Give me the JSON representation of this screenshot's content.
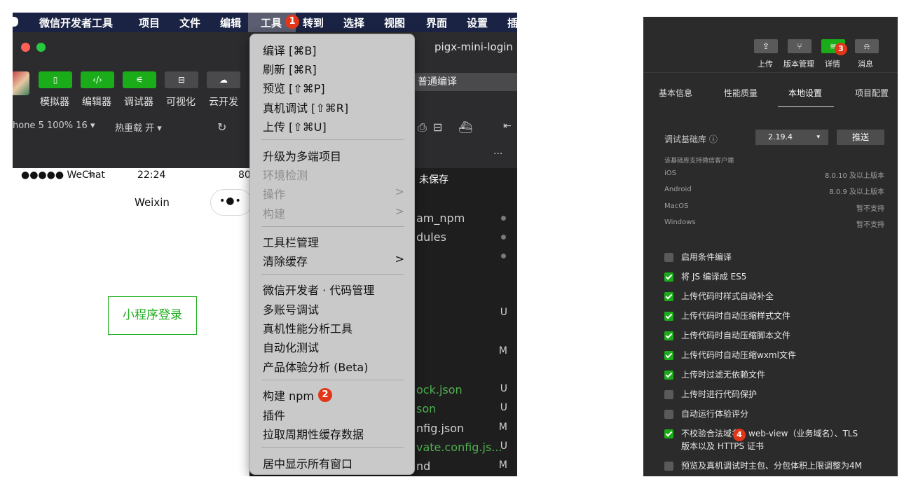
{
  "left": {
    "menubar": {
      "items": [
        "微信开发者工具",
        "项目",
        "文件",
        "编辑",
        "工具",
        "转到",
        "选择",
        "视图",
        "界面",
        "设置",
        "插"
      ]
    },
    "title": "pigx-mini-login",
    "toolbar": {
      "buttons": [
        "模拟器",
        "编辑器",
        "调试器",
        "可视化",
        "云开发"
      ],
      "compile_mode": "普通编译"
    },
    "status": {
      "device": "hone 5 100% 16 ▾",
      "hot_reload": "热重载 开 ▾",
      "more": "..."
    },
    "phone": {
      "signal": "●●●●● WeChat",
      "time": "22:24",
      "battery": "80",
      "nav_title": "Weixin",
      "capsule": "•●•",
      "login_button": "小程序登录"
    },
    "editor": {
      "unsaved": "未保存",
      "files": [
        {
          "text": "am_npm",
          "tag": ""
        },
        {
          "text": "dules",
          "tag": ""
        },
        {
          "text": "",
          "tag": ""
        },
        {
          "text": "",
          "tag": "U"
        },
        {
          "text": "",
          "tag": "M"
        },
        {
          "text": "ock.json",
          "tag": "U"
        },
        {
          "text": "son",
          "tag": "U"
        },
        {
          "text": "nfig.json",
          "tag": "M"
        },
        {
          "text": "vate.config.js...",
          "tag": "U"
        },
        {
          "text": "nd",
          "tag": "M"
        }
      ]
    },
    "dropdown": {
      "items": [
        "编译 [⌘B]",
        "刷新 [⌘R]",
        "预览 [⇧⌘P]",
        "真机调试 [⇧⌘R]",
        "上传 [⇧⌘U]",
        "升级为多端项目",
        "环境检测",
        "操作",
        "构建",
        "工具栏管理",
        "清除缓存",
        "微信开发者 · 代码管理",
        "多账号调试",
        "真机性能分析工具",
        "自动化测试",
        "产品体验分析 (Beta)",
        "构建 npm",
        "插件",
        "拉取周期性缓存数据",
        "居中显示所有窗口"
      ],
      "submenu_arrow": ">"
    },
    "badges": [
      "1",
      "2"
    ]
  },
  "right": {
    "toolbar": {
      "buttons": [
        {
          "label": "上传",
          "icon": "upload-icon"
        },
        {
          "label": "版本管理",
          "icon": "branch-icon"
        },
        {
          "label": "详情",
          "icon": "details-icon"
        },
        {
          "label": "消息",
          "icon": "bell-icon"
        }
      ]
    },
    "tabs": [
      "基本信息",
      "性能质量",
      "本地设置",
      "项目配置"
    ],
    "active_tab": "本地设置",
    "sdk": {
      "label": "调试基础库 ⓘ",
      "version": "2.19.4",
      "caret": "▾",
      "push": "推送"
    },
    "support": {
      "title": "该基础库支持微信客户端",
      "rows": [
        {
          "os": "iOS",
          "ver": "8.0.10 及以上版本"
        },
        {
          "os": "Android",
          "ver": "8.0.9 及以上版本"
        },
        {
          "os": "MacOS",
          "ver": "暂不支持"
        },
        {
          "os": "Windows",
          "ver": "暂不支持"
        }
      ]
    },
    "options": [
      {
        "label": "启用条件编译",
        "checked": false
      },
      {
        "label": "将 JS 编译成 ES5",
        "checked": true
      },
      {
        "label": "上传代码时样式自动补全",
        "checked": true
      },
      {
        "label": "上传代码时自动压缩样式文件",
        "checked": true
      },
      {
        "label": "上传代码时自动压缩脚本文件",
        "checked": true
      },
      {
        "label": "上传代码时自动压缩wxml文件",
        "checked": true
      },
      {
        "label": "上传时过滤无依赖文件",
        "checked": true
      },
      {
        "label": "上传时进行代码保护",
        "checked": false
      },
      {
        "label": "自动运行体验评分",
        "checked": false
      },
      {
        "label": "不校验合法域名、web-view（业务域名）、TLS",
        "label2": "版本以及 HTTPS 证书",
        "checked": true
      },
      {
        "label": "预览及真机调试时主包、分包体积上限调整为4M",
        "checked": false
      }
    ],
    "badges": [
      "3",
      "4"
    ]
  },
  "colors": {
    "accent": "#1aad19",
    "badge": "#e2361a",
    "menubar": "#1b2345",
    "dark_bg": "#2c2c2e"
  }
}
